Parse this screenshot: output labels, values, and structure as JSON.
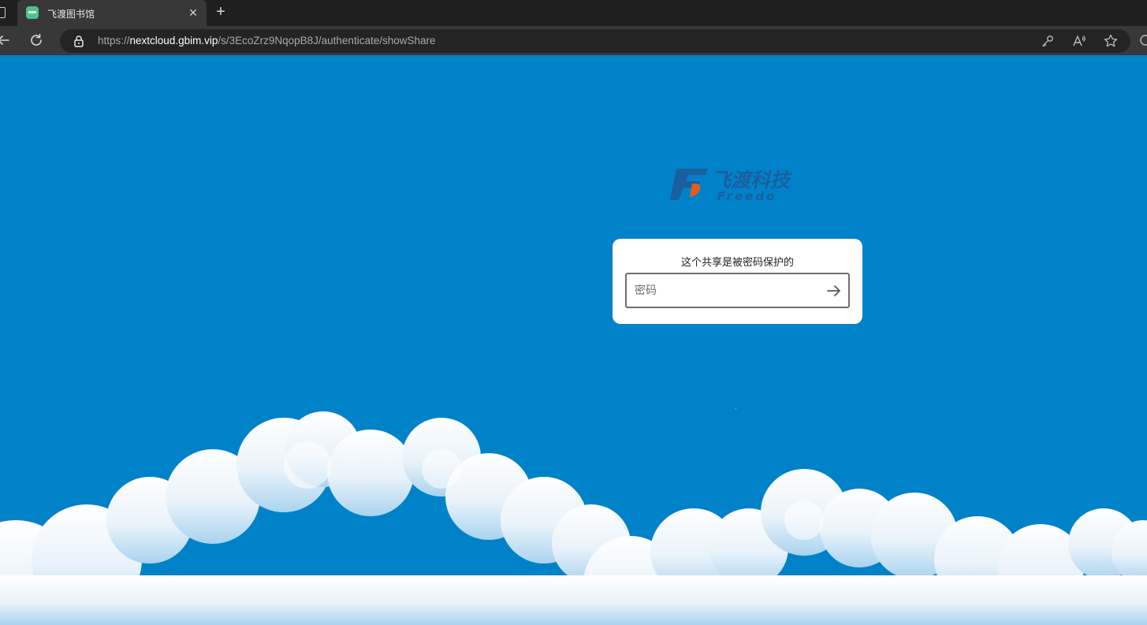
{
  "browser": {
    "tab": {
      "title": "飞渡图书馆",
      "favicon": "freedo-favicon-icon"
    },
    "address_bar": {
      "scheme": "https://",
      "host": "nextcloud.gbim.vip",
      "path": "/s/3EcoZrz9NqopB8J/authenticate/showShare"
    },
    "icons": [
      "back-icon",
      "refresh-icon",
      "lock-icon",
      "key-icon",
      "read-aloud-icon",
      "favorite-star-icon"
    ]
  },
  "page": {
    "logo": {
      "text_cn": "飞渡科技",
      "text_en": "Freedo"
    },
    "share_auth": {
      "title": "这个共享是被密码保护的",
      "password_placeholder": "密码",
      "password_value": ""
    },
    "colors": {
      "background": "#0082c9",
      "card": "#ffffff",
      "logo_mark": "#1a5f9e",
      "logo_accent": "#e35d1f"
    }
  }
}
